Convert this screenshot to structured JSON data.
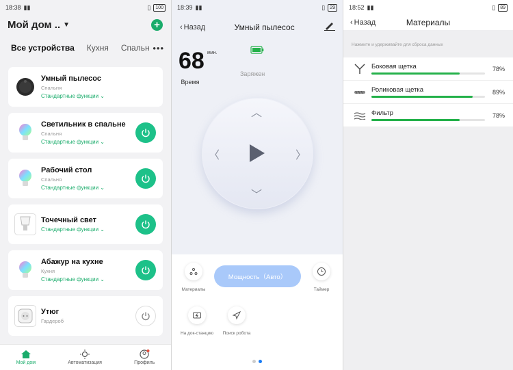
{
  "screen1": {
    "status": {
      "time": "18:38",
      "battery": "100"
    },
    "home_title": "Мой дом ..",
    "tabs": [
      "Все устройства",
      "Кухня",
      "Спальн"
    ],
    "devices": [
      {
        "name": "Умный пылесос",
        "room": "Спальня",
        "func": "Стандартные функции"
      },
      {
        "name": "Светильник в спальне",
        "room": "Спальня",
        "func": "Стандартные функции"
      },
      {
        "name": "Рабочий стол",
        "room": "Спальня",
        "func": "Стандартные функции"
      },
      {
        "name": "Точечный свет",
        "room": "",
        "func": "Стандартные функции"
      },
      {
        "name": "Абажур на кухне",
        "room": "Кухня",
        "func": "Стандартные функции"
      },
      {
        "name": "Утюг",
        "room": "Гардероб",
        "func": ""
      }
    ],
    "nav": {
      "home": "Мой дом",
      "automation": "Автоматизация",
      "profile": "Профиль"
    },
    "colors": {
      "accent": "#1aac6b",
      "power_on": "#1dc189"
    }
  },
  "screen2": {
    "status": {
      "time": "18:39",
      "battery": "29"
    },
    "back": "Назад",
    "title": "Умный пылесос",
    "time_value": "68",
    "time_unit": "мин.",
    "time_label": "Время",
    "charge_label": "Заряжен",
    "materials_label": "Материалы",
    "power_mode": "Мощность（Авто）",
    "timer_label": "Таймер",
    "dock_label": "На док-станцию",
    "find_label": "Поиск робота"
  },
  "screen3": {
    "status": {
      "time": "18:52",
      "battery": "89"
    },
    "back": "Назад",
    "title": "Материалы",
    "hint": "Нажмите и удерживайте для сброса данных",
    "materials": [
      {
        "name": "Боковая щетка",
        "percent": "78%",
        "level": 78
      },
      {
        "name": "Роликовая щетка",
        "percent": "89%",
        "level": 89
      },
      {
        "name": "Фильтр",
        "percent": "78%",
        "level": 78
      }
    ],
    "bar_color": "#24b14a"
  }
}
